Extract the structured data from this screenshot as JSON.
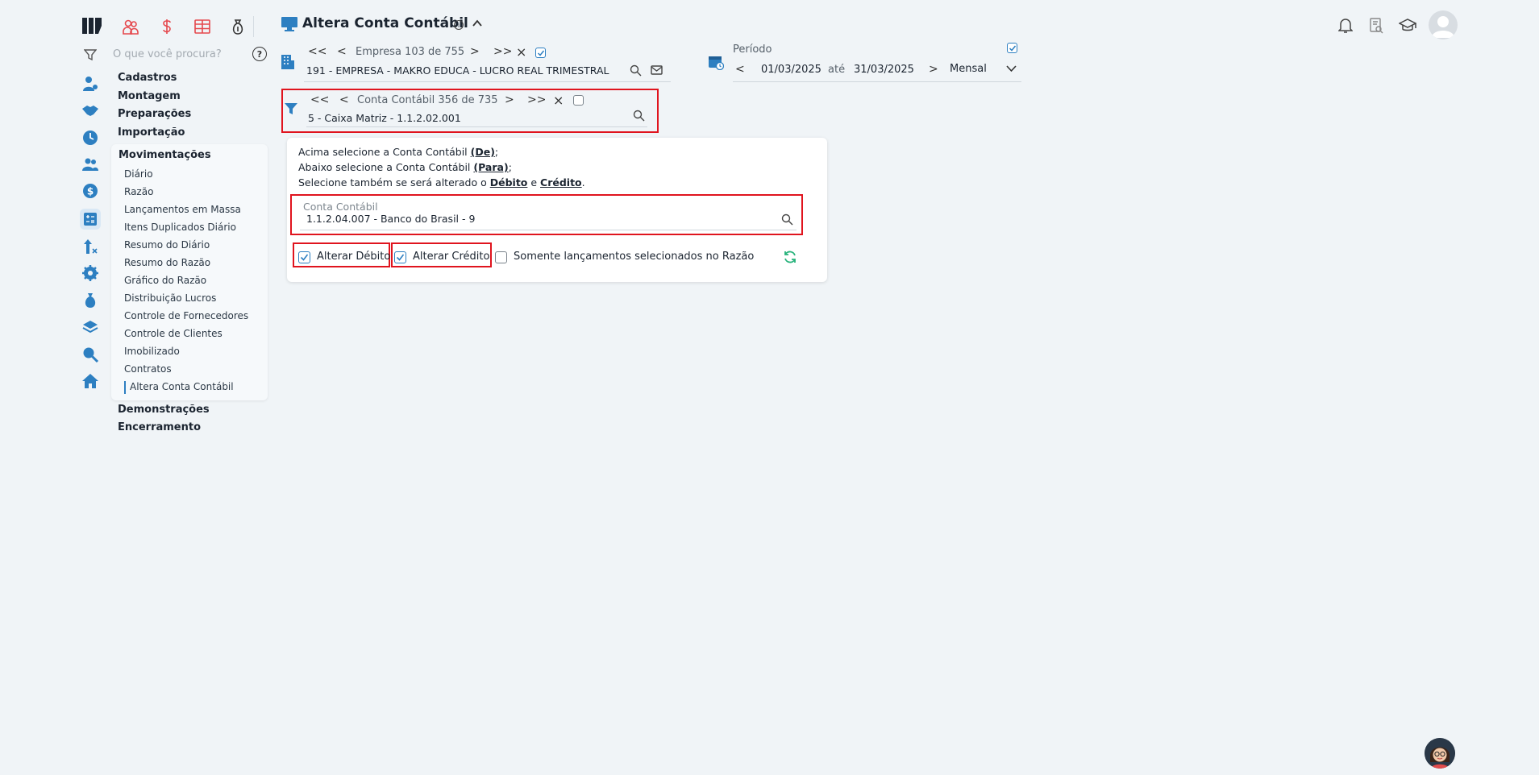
{
  "search": {
    "placeholder": "O que você procura?"
  },
  "help_glyph": "?",
  "menu": {
    "groups": [
      "Cadastros",
      "Montagem",
      "Preparações",
      "Importação",
      "Movimentações",
      "Demonstrações",
      "Encerramento"
    ],
    "movimentacoes_items": [
      "Diário",
      "Razão",
      "Lançamentos em Massa",
      "Itens Duplicados Diário",
      "Resumo do Diário",
      "Resumo do Razão",
      "Gráfico do Razão",
      "Distribuição Lucros",
      "Controle de Fornecedores",
      "Controle de Clientes",
      "Imobilizado",
      "Contratos",
      "Altera Conta Contábil"
    ],
    "active_item": "Altera Conta Contábil"
  },
  "page": {
    "title": "Altera Conta Contábil",
    "info_glyph": "i"
  },
  "company_nav": {
    "first": "<<",
    "prev": "<",
    "next": ">",
    "last": ">>",
    "clear": "×",
    "label": "Empresa 103 de 755",
    "value": "191 - EMPRESA - MAKRO EDUCA - LUCRO REAL TRIMESTRAL"
  },
  "account_nav": {
    "first": "<<",
    "prev": "<",
    "next": ">",
    "last": ">>",
    "clear": "×",
    "label": "Conta Contábil 356 de 735",
    "value": "5 - Caixa Matriz  - 1.1.2.02.001"
  },
  "period": {
    "label": "Período",
    "prev": "<",
    "next": ">",
    "start": "01/03/2025",
    "sep": "até",
    "end": "31/03/2025",
    "mode": "Mensal"
  },
  "instructions": {
    "line1_pre": "Acima selecione a Conta Contábil ",
    "line1_bold": "(De)",
    "line1_post": ";",
    "line2_pre": "Abaixo selecione a Conta Contábil ",
    "line2_bold": "(Para)",
    "line2_post": ";",
    "line3_pre": "Selecione também se será alterado o ",
    "line3_bold1": "Débito",
    "line3_mid": " e ",
    "line3_bold2": "Crédito",
    "line3_post": "."
  },
  "target_field": {
    "label": "Conta Contábil",
    "value": "1.1.2.04.007 - Banco do Brasil - 9"
  },
  "options": {
    "alterar_debito": {
      "label": "Alterar Débito",
      "checked": true
    },
    "alterar_credito": {
      "label": "Alterar Crédito",
      "checked": true
    },
    "somente_selecionados": {
      "label": "Somente lançamentos selecionados no Razão",
      "checked": false
    }
  },
  "colors": {
    "accent": "#2d7fc1",
    "highlight": "#e0141e",
    "module_icons": "#e5484d",
    "refresh": "#25b27a"
  }
}
